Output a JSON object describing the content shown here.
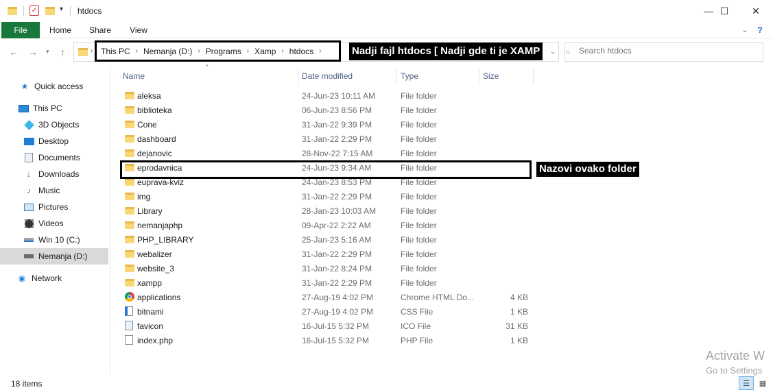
{
  "window": {
    "title": "htdocs",
    "buttons": {
      "minimize": "—",
      "maximize": "☐",
      "close": "✕"
    }
  },
  "ribbon": {
    "tabs": [
      "File",
      "Home",
      "Share",
      "View"
    ],
    "help": "?"
  },
  "address": {
    "breadcrumb": [
      "This PC",
      "Nemanja (D:)",
      "Programs",
      "Xamp",
      "htdocs"
    ],
    "annotation": "Nadji fajl htdocs [ Nadji gde ti je XAMP"
  },
  "search": {
    "placeholder": "Search htdocs"
  },
  "nav": {
    "items": [
      {
        "label": "Quick access",
        "icon": "star-icon"
      },
      {
        "label": "This PC",
        "icon": "computer-icon"
      },
      {
        "label": "3D Objects",
        "icon": "cube-icon"
      },
      {
        "label": "Desktop",
        "icon": "desktop-icon"
      },
      {
        "label": "Documents",
        "icon": "documents-icon"
      },
      {
        "label": "Downloads",
        "icon": "download-icon"
      },
      {
        "label": "Music",
        "icon": "music-icon"
      },
      {
        "label": "Pictures",
        "icon": "pictures-icon"
      },
      {
        "label": "Videos",
        "icon": "video-icon"
      },
      {
        "label": "Win 10 (C:)",
        "icon": "drive-icon"
      },
      {
        "label": "Nemanja (D:)",
        "icon": "drive-icon",
        "selected": true
      },
      {
        "label": "Network",
        "icon": "network-icon"
      }
    ]
  },
  "columns": {
    "name": "Name",
    "date": "Date modified",
    "type": "Type",
    "size": "Size"
  },
  "files": [
    {
      "name": "aleksa",
      "date": "24-Jun-23 10:11 AM",
      "type": "File folder",
      "size": "",
      "icon": "folder-icon"
    },
    {
      "name": "biblioteka",
      "date": "06-Jun-23 8:56 PM",
      "type": "File folder",
      "size": "",
      "icon": "folder-icon"
    },
    {
      "name": "Cone",
      "date": "31-Jan-22 9:39 PM",
      "type": "File folder",
      "size": "",
      "icon": "folder-icon"
    },
    {
      "name": "dashboard",
      "date": "31-Jan-22 2:29 PM",
      "type": "File folder",
      "size": "",
      "icon": "folder-icon"
    },
    {
      "name": "dejanovic",
      "date": "28-Nov-22 7:15 AM",
      "type": "File folder",
      "size": "",
      "icon": "folder-icon"
    },
    {
      "name": "eprodavnica",
      "date": "24-Jun-23 9:34 AM",
      "type": "File folder",
      "size": "",
      "icon": "folder-icon"
    },
    {
      "name": "euprava-kviz",
      "date": "24-Jan-23 8:53 PM",
      "type": "File folder",
      "size": "",
      "icon": "folder-icon"
    },
    {
      "name": "img",
      "date": "31-Jan-22 2:29 PM",
      "type": "File folder",
      "size": "",
      "icon": "folder-icon"
    },
    {
      "name": "Library",
      "date": "28-Jan-23 10:03 AM",
      "type": "File folder",
      "size": "",
      "icon": "folder-icon"
    },
    {
      "name": "nemanjaphp",
      "date": "09-Apr-22 2:22 AM",
      "type": "File folder",
      "size": "",
      "icon": "folder-icon"
    },
    {
      "name": "PHP_LIBRARY",
      "date": "25-Jan-23 5:16 AM",
      "type": "File folder",
      "size": "",
      "icon": "folder-icon"
    },
    {
      "name": "webalizer",
      "date": "31-Jan-22 2:29 PM",
      "type": "File folder",
      "size": "",
      "icon": "folder-icon"
    },
    {
      "name": "website_3",
      "date": "31-Jan-22 8:24 PM",
      "type": "File folder",
      "size": "",
      "icon": "folder-icon"
    },
    {
      "name": "xampp",
      "date": "31-Jan-22 2:29 PM",
      "type": "File folder",
      "size": "",
      "icon": "folder-icon"
    },
    {
      "name": "applications",
      "date": "27-Aug-19 4:02 PM",
      "type": "Chrome HTML Do...",
      "size": "4 KB",
      "icon": "chrome-icon"
    },
    {
      "name": "bitnami",
      "date": "27-Aug-19 4:02 PM",
      "type": "CSS File",
      "size": "1 KB",
      "icon": "css-file-icon"
    },
    {
      "name": "favicon",
      "date": "16-Jul-15 5:32 PM",
      "type": "ICO File",
      "size": "31 KB",
      "icon": "image-file-icon"
    },
    {
      "name": "index.php",
      "date": "16-Jul-15 5:32 PM",
      "type": "PHP File",
      "size": "1 KB",
      "icon": "file-icon"
    }
  ],
  "highlight_annotation": "Nazovi ovako folder",
  "status": {
    "items": "18 items"
  },
  "watermark": {
    "line1": "Activate W",
    "line2": "Go to Settings"
  },
  "colors": {
    "file_tab": "#19783c",
    "header_text": "#4d6185",
    "selected_nav": "#d9d9d9",
    "folder": "#f8d775"
  }
}
